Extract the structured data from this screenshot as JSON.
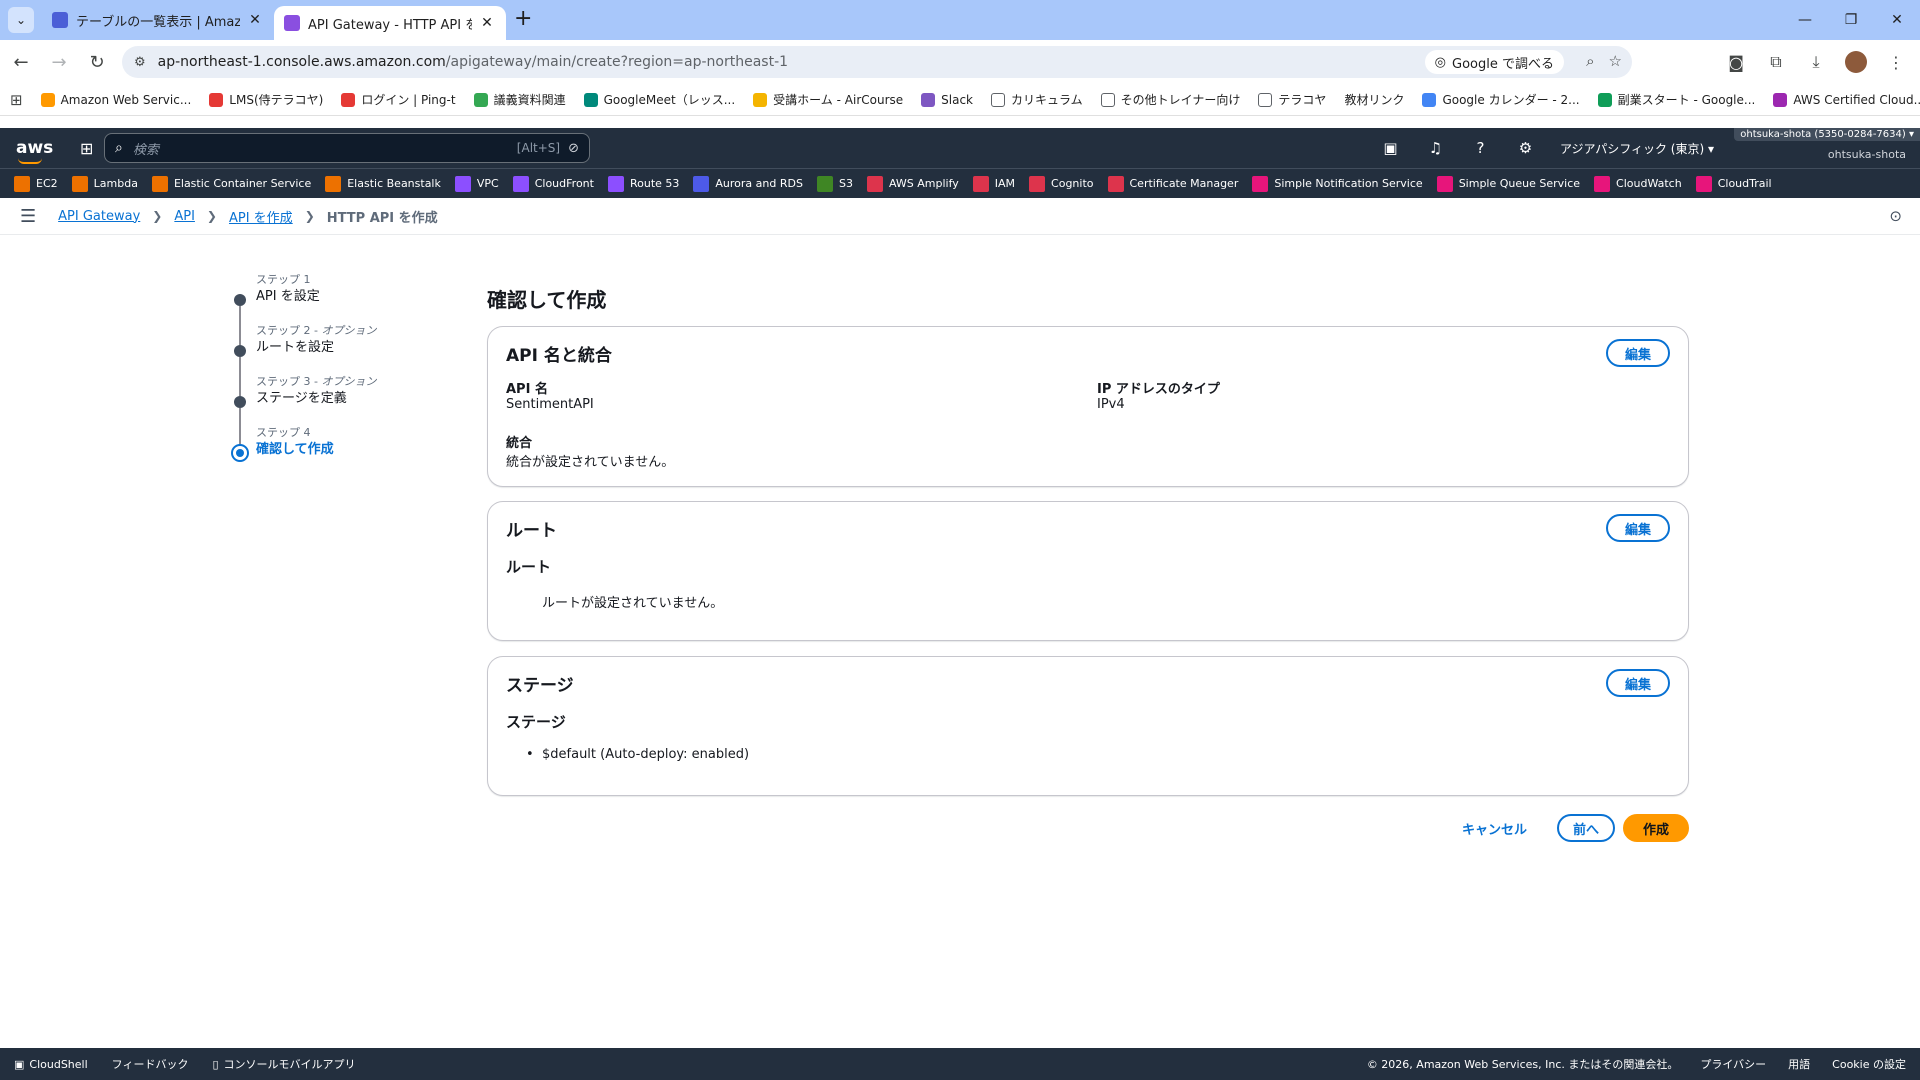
{
  "browser": {
    "tabs": [
      {
        "title": "テーブルの一覧表示 | Amazon Dyn",
        "active": false,
        "color": "#4b5fd6"
      },
      {
        "title": "API Gateway - HTTP API を作成",
        "active": true,
        "color": "#8a4fe0"
      }
    ],
    "url_host": "ap-northeast-1.console.aws.amazon.com",
    "url_path": "/apigateway/main/create?region=ap-northeast-1",
    "google_search_label": "Google で調べる",
    "bookmarks": [
      {
        "label": "Amazon Web Servic...",
        "color": "#ff9900"
      },
      {
        "label": "LMS(侍テラコヤ)",
        "color": "#e53935"
      },
      {
        "label": "ログイン | Ping-t",
        "color": "#e53935"
      },
      {
        "label": "議義資料関連",
        "color": "#34a853"
      },
      {
        "label": "GoogleMeet（レッス...",
        "color": "#00897b"
      },
      {
        "label": "受講ホーム - AirCourse",
        "color": "#f4b400"
      },
      {
        "label": "Slack",
        "color": "#7e57c2"
      },
      {
        "label": "カリキュラム",
        "color": "#5f6368"
      },
      {
        "label": "その他トレイナー向け",
        "color": "#5f6368"
      },
      {
        "label": "テラコヤ",
        "color": "#5f6368"
      },
      {
        "label": "教材リンク",
        "color": "#ffffff"
      },
      {
        "label": "Google カレンダー - 2...",
        "color": "#4285f4"
      },
      {
        "label": "副業スタート - Google...",
        "color": "#0f9d58"
      },
      {
        "label": "AWS Certified Cloud...",
        "color": "#9c27b0"
      }
    ]
  },
  "aws_nav": {
    "logo": "aws",
    "search_placeholder": "検索",
    "search_shortcut": "[Alt+S]",
    "region": "アジアパシフィック (東京) ▾",
    "account_tag": "ohtsuka-shota (5350-0284-7634) ▾",
    "account_name": "ohtsuka-shota",
    "services": [
      {
        "label": "EC2",
        "color": "#ed7100"
      },
      {
        "label": "Lambda",
        "color": "#ed7100"
      },
      {
        "label": "Elastic Container Service",
        "color": "#ed7100"
      },
      {
        "label": "Elastic Beanstalk",
        "color": "#ed7100"
      },
      {
        "label": "VPC",
        "color": "#8c4fff"
      },
      {
        "label": "CloudFront",
        "color": "#8c4fff"
      },
      {
        "label": "Route 53",
        "color": "#8c4fff"
      },
      {
        "label": "Aurora and RDS",
        "color": "#4d5ae8"
      },
      {
        "label": "S3",
        "color": "#3f8624"
      },
      {
        "label": "AWS Amplify",
        "color": "#dd344c"
      },
      {
        "label": "IAM",
        "color": "#dd344c"
      },
      {
        "label": "Cognito",
        "color": "#dd344c"
      },
      {
        "label": "Certificate Manager",
        "color": "#dd344c"
      },
      {
        "label": "Simple Notification Service",
        "color": "#e7157b"
      },
      {
        "label": "Simple Queue Service",
        "color": "#e7157b"
      },
      {
        "label": "CloudWatch",
        "color": "#e7157b"
      },
      {
        "label": "CloudTrail",
        "color": "#e7157b"
      }
    ]
  },
  "breadcrumb": {
    "items": [
      "API Gateway",
      "API",
      "API を作成"
    ],
    "current": "HTTP API を作成"
  },
  "steps": [
    {
      "num": "ステップ 1",
      "opt": "",
      "label": "API を設定"
    },
    {
      "num": "ステップ 2 - ",
      "opt": "オプション",
      "label": "ルートを設定"
    },
    {
      "num": "ステップ 3 - ",
      "opt": "オプション",
      "label": "ステージを定義"
    },
    {
      "num": "ステップ 4",
      "opt": "",
      "label": "確認して作成"
    }
  ],
  "page_title": "確認して作成",
  "edit_label": "編集",
  "section_api": {
    "title": "API 名と統合",
    "api_name_label": "API 名",
    "api_name_value": "SentimentAPI",
    "ip_label": "IP アドレスのタイプ",
    "ip_value": "IPv4",
    "integration_label": "統合",
    "integration_value": "統合が設定されていません。"
  },
  "section_routes": {
    "title": "ルート",
    "subtitle": "ルート",
    "empty": "ルートが設定されていません。"
  },
  "section_stages": {
    "title": "ステージ",
    "subtitle": "ステージ",
    "item": "$default (Auto-deploy: enabled)"
  },
  "actions": {
    "cancel": "キャンセル",
    "previous": "前へ",
    "create": "作成"
  },
  "footer": {
    "cloudshell": "CloudShell",
    "feedback": "フィードバック",
    "mobile_app": "コンソールモバイルアプリ",
    "copyright": "© 2026, Amazon Web Services, Inc. またはその関連会社。",
    "privacy": "プライバシー",
    "terms": "用語",
    "cookie": "Cookie の設定"
  }
}
